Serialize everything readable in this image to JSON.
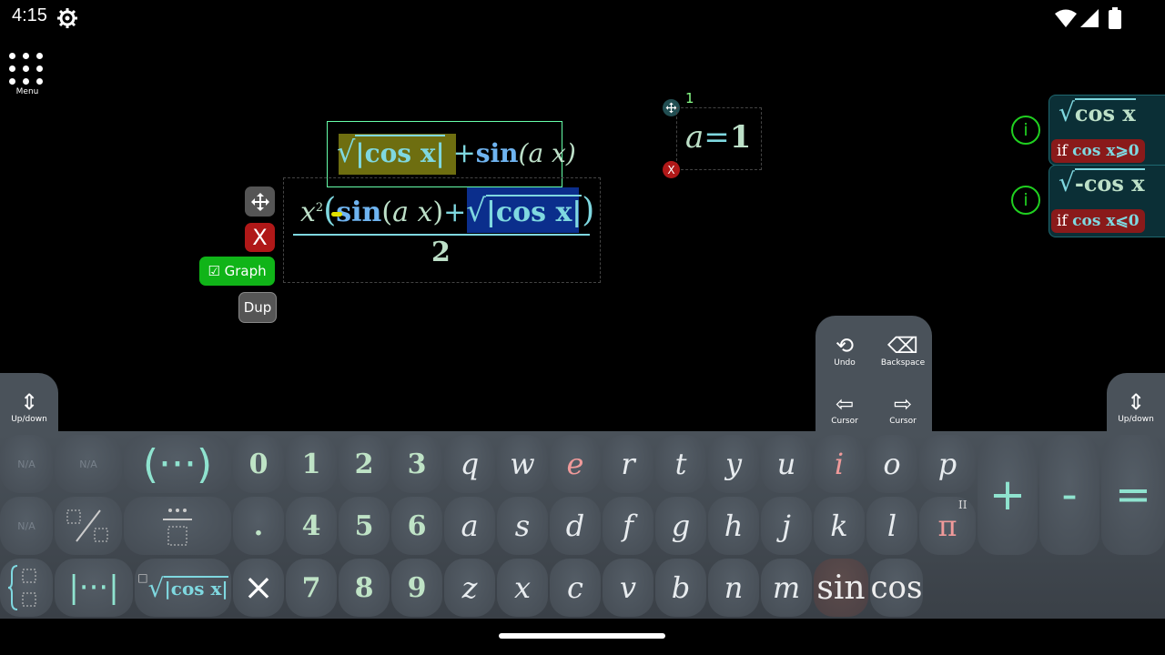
{
  "status_bar": {
    "time": "4:15"
  },
  "menu": {
    "label": "Menu"
  },
  "formula": {
    "selected_top": {
      "sqrt_inner": "|cos x|",
      "plus": "+",
      "sin": "sin",
      "arg": "(a x)"
    },
    "numerator": {
      "x2": "x",
      "exp": "2",
      "sin": "sin",
      "arg": "a x",
      "plus": "+",
      "sqrt_inner": "|cos x|"
    },
    "denominator": "2"
  },
  "side_buttons": {
    "graph": "☑ Graph",
    "dup": "Dup"
  },
  "variable": {
    "index": "1",
    "name": "a",
    "eq": "=",
    "value": "1",
    "delete": "X"
  },
  "conditions": [
    {
      "expr": "cos x",
      "prefix": "",
      "cond_label": "if",
      "cond": "cos x⩾0"
    },
    {
      "expr": "cos x",
      "prefix": "-",
      "cond_label": "if",
      "cond": "cos x⩽0"
    }
  ],
  "keyboard": {
    "updown_left": "Up/down",
    "updown_right": "Up/down",
    "undo": "Undo",
    "backspace": "Backspace",
    "cursor_left": "Cursor",
    "cursor_right": "Cursor",
    "na": "N/A",
    "paren": "(···)",
    "abs": "|···|",
    "row1_digits": [
      "0",
      "1",
      "2",
      "3"
    ],
    "row1_letters": [
      "q",
      "w",
      "e",
      "r",
      "t",
      "y",
      "u",
      "i",
      "o",
      "p"
    ],
    "row2_digits": [
      ".",
      "4",
      "5",
      "6"
    ],
    "row2_letters": [
      "a",
      "s",
      "d",
      "f",
      "g",
      "h",
      "j",
      "k",
      "l",
      "π"
    ],
    "row3_digits": [
      "×",
      "7",
      "8",
      "9"
    ],
    "row3_letters": [
      "z",
      "x",
      "c",
      "v",
      "b",
      "n",
      "m"
    ],
    "sin": "sin",
    "cos": "cos",
    "plus": "+",
    "minus": "-",
    "equals": "=",
    "pi_super": "II",
    "sqrt_key": "|cos x|"
  },
  "colors": {
    "accent": "#7fd8e0",
    "graph_green": "#10b418",
    "delete_red": "#b01818",
    "condition_bg": "#0b2f36"
  }
}
